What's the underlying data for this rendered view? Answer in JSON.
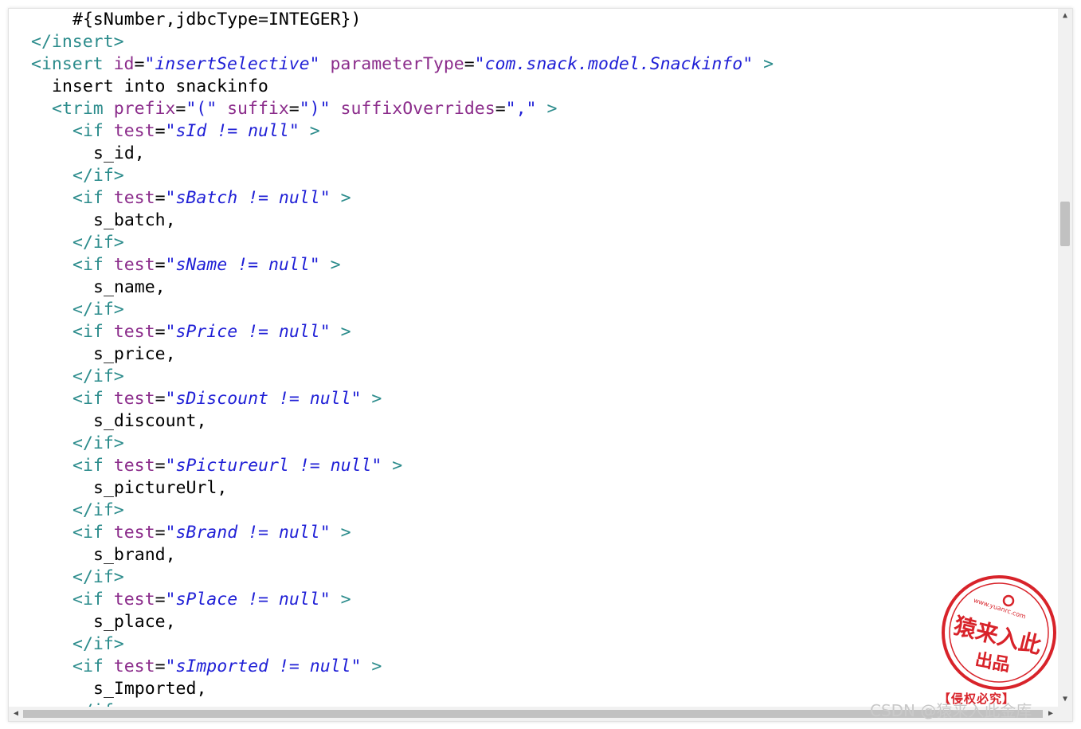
{
  "colors": {
    "tag": "#2c8c8c",
    "attribute": "#8b2c8b",
    "value": "#1f1fd6",
    "text": "#000000",
    "stamp": "#d8232a",
    "watermark": "#c9c9c9"
  },
  "code_lines": [
    {
      "indent": 2,
      "text": "#{sNumber,jdbcType=INTEGER})"
    },
    {
      "indent": 0,
      "close_tag": "insert"
    },
    {
      "indent": 0,
      "open_tag": "insert",
      "attrs": [
        {
          "name": "id",
          "value": "\"insertSelective\""
        },
        {
          "name": "parameterType",
          "value": "\"com.snack.model.Snackinfo\""
        }
      ]
    },
    {
      "indent": 1,
      "text": "insert into snackinfo"
    },
    {
      "indent": 1,
      "open_tag": "trim",
      "attrs": [
        {
          "name": "prefix",
          "value": "\"(\"",
          "plain": true
        },
        {
          "name": "suffix",
          "value": "\")\"",
          "plain": true
        },
        {
          "name": "suffixOverrides",
          "value": "\",\"",
          "plain": true
        }
      ]
    },
    {
      "indent": 2,
      "open_tag": "if",
      "attrs": [
        {
          "name": "test",
          "value": "\"sId != null\""
        }
      ]
    },
    {
      "indent": 3,
      "text": "s_id,"
    },
    {
      "indent": 2,
      "close_tag": "if"
    },
    {
      "indent": 2,
      "open_tag": "if",
      "attrs": [
        {
          "name": "test",
          "value": "\"sBatch != null\""
        }
      ]
    },
    {
      "indent": 3,
      "text": "s_batch,"
    },
    {
      "indent": 2,
      "close_tag": "if"
    },
    {
      "indent": 2,
      "open_tag": "if",
      "attrs": [
        {
          "name": "test",
          "value": "\"sName != null\""
        }
      ]
    },
    {
      "indent": 3,
      "text": "s_name,"
    },
    {
      "indent": 2,
      "close_tag": "if"
    },
    {
      "indent": 2,
      "open_tag": "if",
      "attrs": [
        {
          "name": "test",
          "value": "\"sPrice != null\""
        }
      ]
    },
    {
      "indent": 3,
      "text": "s_price,"
    },
    {
      "indent": 2,
      "close_tag": "if"
    },
    {
      "indent": 2,
      "open_tag": "if",
      "attrs": [
        {
          "name": "test",
          "value": "\"sDiscount != null\""
        }
      ]
    },
    {
      "indent": 3,
      "text": "s_discount,"
    },
    {
      "indent": 2,
      "close_tag": "if"
    },
    {
      "indent": 2,
      "open_tag": "if",
      "attrs": [
        {
          "name": "test",
          "value": "\"sPictureurl != null\""
        }
      ]
    },
    {
      "indent": 3,
      "text": "s_pictureUrl,"
    },
    {
      "indent": 2,
      "close_tag": "if"
    },
    {
      "indent": 2,
      "open_tag": "if",
      "attrs": [
        {
          "name": "test",
          "value": "\"sBrand != null\""
        }
      ]
    },
    {
      "indent": 3,
      "text": "s_brand,"
    },
    {
      "indent": 2,
      "close_tag": "if"
    },
    {
      "indent": 2,
      "open_tag": "if",
      "attrs": [
        {
          "name": "test",
          "value": "\"sPlace != null\""
        }
      ]
    },
    {
      "indent": 3,
      "text": "s_place,"
    },
    {
      "indent": 2,
      "close_tag": "if"
    },
    {
      "indent": 2,
      "open_tag": "if",
      "attrs": [
        {
          "name": "test",
          "value": "\"sImported != null\""
        }
      ]
    },
    {
      "indent": 3,
      "text": "s_Imported,"
    },
    {
      "indent": 2,
      "close_tag": "if"
    }
  ],
  "stamp": {
    "url": "www.yuanrc.com",
    "main_text": "猿来入此",
    "sub_text": "出品",
    "caption": "【侵权必究】"
  },
  "watermark": "CSDN @猿来入此金库",
  "scrollbars": {
    "vertical_position": 0.27,
    "horizontal_position": 0.0
  }
}
